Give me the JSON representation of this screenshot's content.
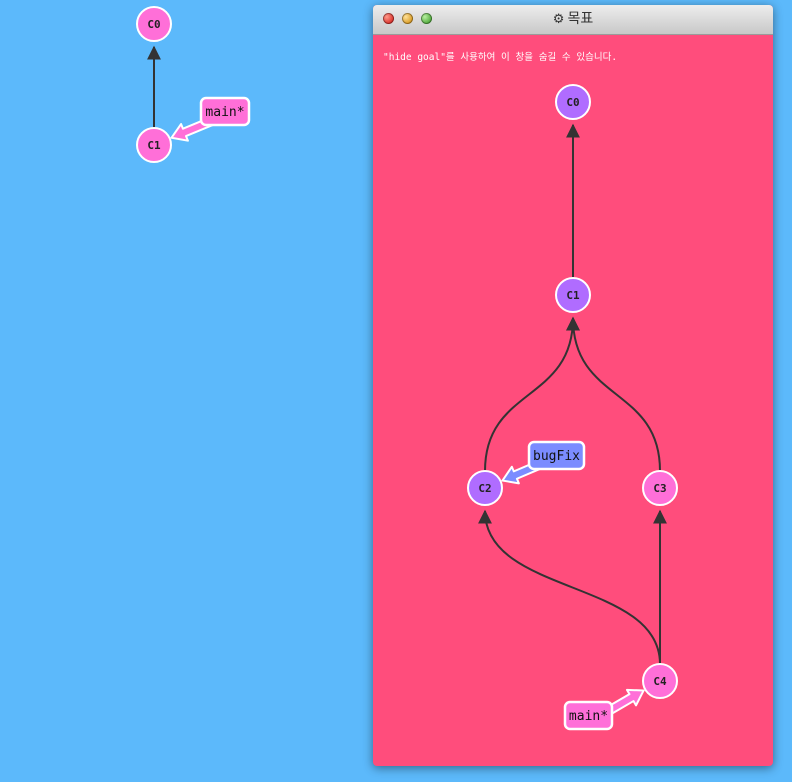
{
  "colors": {
    "background": "#5cb9fb",
    "goal_background": "#ff4d7c",
    "commit_main": "#ff6fd8",
    "commit_bugfix": "#b06cff",
    "branch_main": "#ff6fd8",
    "branch_bugfix": "#7b8cff",
    "edge": "#333333"
  },
  "current_tree": {
    "commits": [
      {
        "id": "C0",
        "color": "commit_main"
      },
      {
        "id": "C1",
        "color": "commit_main"
      }
    ],
    "edges": [
      {
        "from": "C1",
        "to": "C0"
      }
    ],
    "branches": [
      {
        "name": "main*",
        "target": "C1",
        "color": "branch_main"
      }
    ]
  },
  "goal_window": {
    "title": "목표",
    "title_icon": "gear-icon",
    "hint": "\"hide goal\"를 사용하여 이 창을 숨길 수 있습니다.",
    "commits": [
      {
        "id": "C0",
        "color": "commit_bugfix"
      },
      {
        "id": "C1",
        "color": "commit_bugfix"
      },
      {
        "id": "C2",
        "color": "commit_bugfix"
      },
      {
        "id": "C3",
        "color": "commit_main"
      },
      {
        "id": "C4",
        "color": "commit_main"
      }
    ],
    "edges": [
      {
        "from": "C1",
        "to": "C0"
      },
      {
        "from": "C2",
        "to": "C1"
      },
      {
        "from": "C3",
        "to": "C1"
      },
      {
        "from": "C4",
        "to": "C2"
      },
      {
        "from": "C4",
        "to": "C3"
      }
    ],
    "branches": [
      {
        "name": "bugFix",
        "target": "C2",
        "color": "branch_bugfix"
      },
      {
        "name": "main*",
        "target": "C4",
        "color": "branch_main"
      }
    ]
  }
}
